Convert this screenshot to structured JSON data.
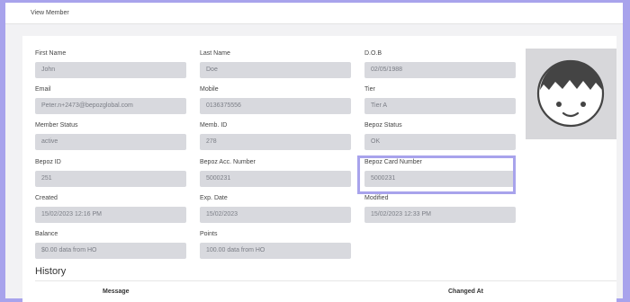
{
  "header": {
    "title": "View Member"
  },
  "fields": [
    {
      "label": "First Name",
      "value": "John"
    },
    {
      "label": "Last Name",
      "value": "Doe"
    },
    {
      "label": "D.O.B",
      "value": "02/05/1988"
    },
    {
      "label": "Email",
      "value": "Peter.n+2473@bepozglobal.com"
    },
    {
      "label": "Mobile",
      "value": "0136375556"
    },
    {
      "label": "Tier",
      "value": "Tier A"
    },
    {
      "label": "Member Status",
      "value": "active"
    },
    {
      "label": "Memb. ID",
      "value": "278"
    },
    {
      "label": "Bepoz Status",
      "value": "OK"
    },
    {
      "label": "Bepoz ID",
      "value": "251"
    },
    {
      "label": "Bepoz Acc. Number",
      "value": "5000231"
    },
    {
      "label": "Bepoz Card Number",
      "value": "5000231"
    },
    {
      "label": "Created",
      "value": "15/02/2023  12:16  PM"
    },
    {
      "label": "Exp. Date",
      "value": "15/02/2023"
    },
    {
      "label": "Modified",
      "value": "15/02/2023  12:33  PM"
    },
    {
      "label": "Balance",
      "value": "$0.00 data from HO"
    },
    {
      "label": "Points",
      "value": "100.00 data from HO"
    }
  ],
  "history": {
    "title": "History",
    "columns": [
      "Message",
      "Changed At"
    ]
  },
  "colors": {
    "accent": "#a8a3ec",
    "input_bg": "#d8d9de",
    "avatar_bg": "#d7d7da"
  }
}
